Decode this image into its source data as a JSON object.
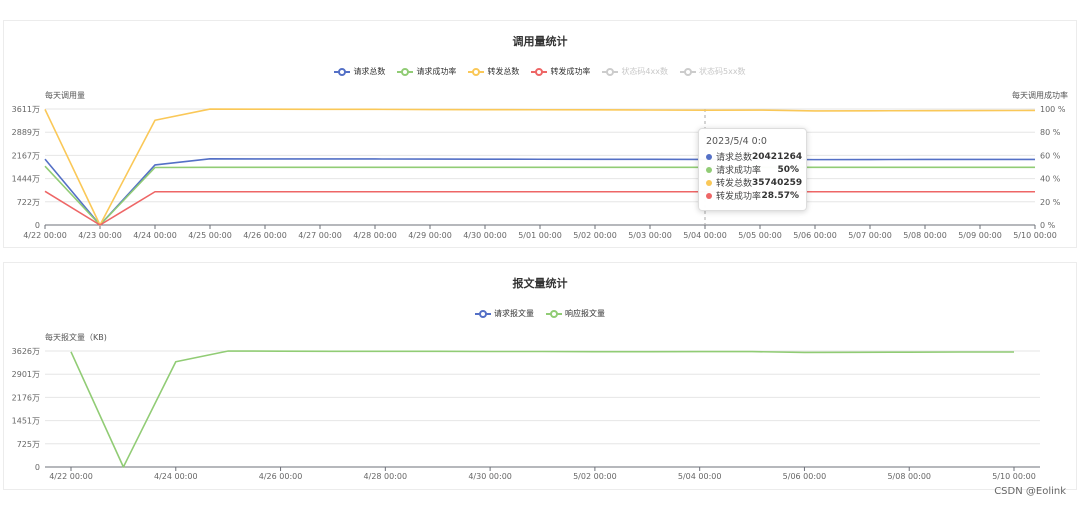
{
  "watermark": "CSDN @Eolink",
  "chart_data": [
    {
      "type": "line",
      "title": "调用量统计",
      "legend": [
        {
          "name": "请求总数",
          "color": "#5470c6",
          "active": true
        },
        {
          "name": "请求成功率",
          "color": "#91cc75",
          "active": true
        },
        {
          "name": "转发总数",
          "color": "#fac858",
          "active": true
        },
        {
          "name": "转发成功率",
          "color": "#ee6666",
          "active": true
        },
        {
          "name": "状态码4xx数",
          "color": "#cccccc",
          "active": false
        },
        {
          "name": "状态码5xx数",
          "color": "#cccccc",
          "active": false
        }
      ],
      "legend_placement": "top-center",
      "ylabel_left": "每天调用量",
      "ylabel_right": "每天调用成功率",
      "x": [
        "4/22 00:00",
        "4/23 00:00",
        "4/24 00:00",
        "4/25 00:00",
        "4/26 00:00",
        "4/27 00:00",
        "4/28 00:00",
        "4/29 00:00",
        "4/30 00:00",
        "5/01 00:00",
        "5/02 00:00",
        "5/03 00:00",
        "5/04 00:00",
        "5/05 00:00",
        "5/06 00:00",
        "5/07 00:00",
        "5/08 00:00",
        "5/09 00:00",
        "5/10 00:00"
      ],
      "yticks_left": [
        "0",
        "722万",
        "1444万",
        "2167万",
        "2889万",
        "3611万"
      ],
      "ylim_left": [
        0,
        36110000
      ],
      "yticks_right": [
        "0 %",
        "20 %",
        "40 %",
        "60 %",
        "80 %",
        "100 %"
      ],
      "ylim_right": [
        0,
        100
      ],
      "grid": true,
      "series": [
        {
          "name": "请求总数",
          "axis": "left",
          "color": "#5470c6",
          "values": [
            20500000,
            0,
            18700000,
            20600000,
            20550000,
            20550000,
            20550000,
            20520000,
            20480000,
            20470000,
            20450000,
            20440000,
            20421264,
            20430000,
            20350000,
            20380000,
            20400000,
            20400000,
            20420000
          ]
        },
        {
          "name": "请求成功率",
          "axis": "left",
          "color": "#91cc75",
          "values": [
            18300000,
            0,
            17900000,
            17950000,
            17950000,
            17950000,
            17950000,
            17950000,
            17950000,
            17950000,
            17950000,
            17950000,
            17950000,
            17950000,
            17950000,
            17950000,
            17950000,
            17950000,
            17950000
          ]
        },
        {
          "name": "转发总数",
          "axis": "left",
          "color": "#fac858",
          "values": [
            36000000,
            0,
            32600000,
            36100000,
            36050000,
            36000000,
            36000000,
            35950000,
            35900000,
            35880000,
            35850000,
            35800000,
            35740259,
            35780000,
            35500000,
            35550000,
            35600000,
            35620000,
            35650000
          ]
        },
        {
          "name": "转发成功率",
          "axis": "left",
          "color": "#ee6666",
          "values": [
            10500000,
            0,
            10350000,
            10350000,
            10350000,
            10350000,
            10350000,
            10350000,
            10350000,
            10350000,
            10350000,
            10350000,
            10350000,
            10350000,
            10350000,
            10350000,
            10350000,
            10350000,
            10350000
          ]
        }
      ],
      "tooltip": {
        "title": "2023/5/4 0:0",
        "rows": [
          {
            "name": "请求总数",
            "value": "20421264",
            "color": "#5470c6"
          },
          {
            "name": "请求成功率",
            "value": "50%",
            "color": "#91cc75"
          },
          {
            "name": "转发总数",
            "value": "35740259",
            "color": "#fac858"
          },
          {
            "name": "转发成功率",
            "value": "28.57%",
            "color": "#ee6666"
          }
        ],
        "at_index": 12
      }
    },
    {
      "type": "line",
      "title": "报文量统计",
      "legend": [
        {
          "name": "请求报文量",
          "color": "#5470c6",
          "active": true
        },
        {
          "name": "响应报文量",
          "color": "#91cc75",
          "active": true
        }
      ],
      "legend_placement": "top-center",
      "ylabel": "每天报文量（KB)",
      "x": [
        "4/22 00:00",
        "4/23 00:00",
        "4/24 00:00",
        "4/25 00:00",
        "4/26 00:00",
        "4/27 00:00",
        "4/28 00:00",
        "4/29 00:00",
        "4/30 00:00",
        "5/01 00:00",
        "5/02 00:00",
        "5/03 00:00",
        "5/04 00:00",
        "5/05 00:00",
        "5/06 00:00",
        "5/07 00:00",
        "5/08 00:00",
        "5/09 00:00",
        "5/10 00:00"
      ],
      "xticks_shown": [
        "4/22 00:00",
        "4/24 00:00",
        "4/26 00:00",
        "4/28 00:00",
        "4/30 00:00",
        "5/02 00:00",
        "5/04 00:00",
        "5/06 00:00",
        "5/08 00:00",
        "5/10 00:00"
      ],
      "yticks": [
        "0",
        "725万",
        "1451万",
        "2176万",
        "2901万",
        "3626万"
      ],
      "ylim": [
        0,
        36260000
      ],
      "grid": true,
      "series": [
        {
          "name": "响应报文量",
          "color": "#91cc75",
          "values": [
            36000000,
            0,
            32900000,
            36260000,
            36200000,
            36150000,
            36150000,
            36150000,
            36100000,
            36100000,
            36050000,
            36050000,
            36080000,
            36080000,
            35800000,
            35850000,
            35900000,
            35950000,
            35950000
          ]
        }
      ]
    }
  ]
}
